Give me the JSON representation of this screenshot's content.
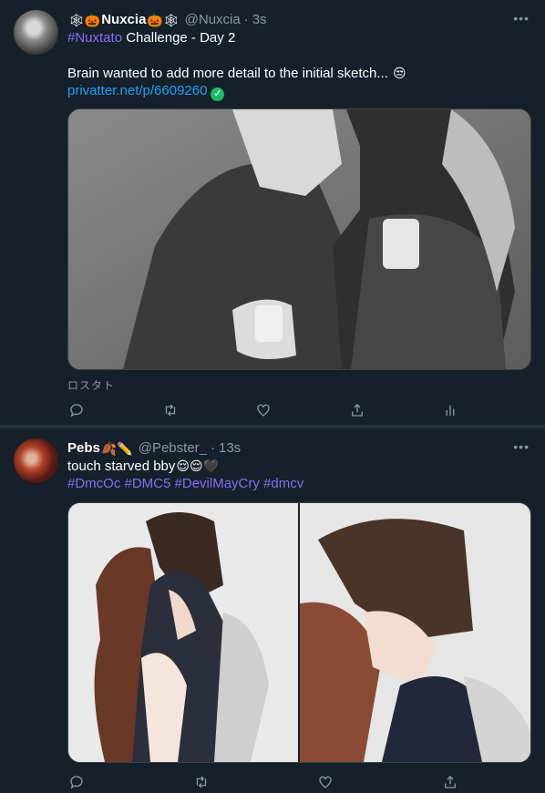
{
  "tweets": [
    {
      "name": "Nuxcia",
      "name_prefix_emoji": "🕸🎃",
      "name_suffix_emoji": "🎃🕸",
      "handle": "@Nuxcia",
      "time": "3s",
      "tag_line_tag": "#Nuxtato",
      "tag_line_rest": " Challenge - Day 2",
      "text": "Brain wanted to add more detail to the initial sketch...",
      "text_emoji": "😒",
      "link": "privatter.net/p/6609260",
      "caption": "ロスタト"
    },
    {
      "name": "Pebs",
      "name_suffix_emoji": "🍂✏️",
      "handle": "@Pebster_",
      "time": "13s",
      "text": "touch starved bby",
      "text_emoji": "😌😌🖤",
      "hashtags": "#DmcOc #DMC5 #DevilMayCry #dmcv"
    }
  ],
  "icons": [
    "reply-icon",
    "retweet-icon",
    "like-icon",
    "share-icon",
    "analytics-icon",
    "more-icon"
  ]
}
